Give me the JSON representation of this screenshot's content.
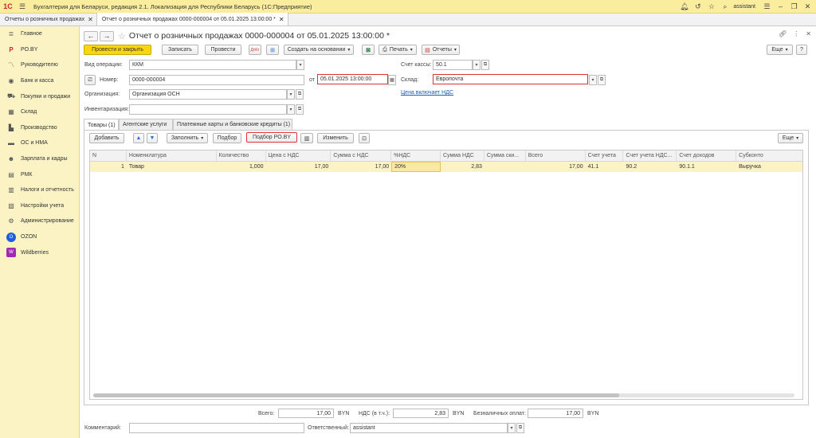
{
  "app": {
    "title": "Бухгалтерия для Беларуси, редакция 2.1. Локализация для Республики Беларусь   (1С:Предприятие)",
    "user": "assistant"
  },
  "window_tabs": [
    {
      "label": "Отчеты о розничных продажах"
    },
    {
      "label": "Отчет о розничных продажах 0000-000004 от 05.01.2025 13:00:00 *"
    }
  ],
  "sidebar": {
    "items": [
      {
        "label": "Главное",
        "icon": "menu-icon"
      },
      {
        "label": "PO.BY",
        "icon": "poby-icon"
      },
      {
        "label": "Руководителю",
        "icon": "chart-icon"
      },
      {
        "label": "Банк и касса",
        "icon": "bank-icon"
      },
      {
        "label": "Покупки и продажи",
        "icon": "cart-icon"
      },
      {
        "label": "Склад",
        "icon": "warehouse-icon"
      },
      {
        "label": "Производство",
        "icon": "factory-icon"
      },
      {
        "label": "ОС и НМА",
        "icon": "assets-icon"
      },
      {
        "label": "Зарплата и кадры",
        "icon": "people-icon"
      },
      {
        "label": "РМК",
        "icon": "register-icon"
      },
      {
        "label": "Налоги и отчетность",
        "icon": "taxes-icon"
      },
      {
        "label": "Настройки учета",
        "icon": "settings-doc-icon"
      },
      {
        "label": "Администрирование",
        "icon": "gear-icon"
      },
      {
        "label": "OZON",
        "icon": "ozon-icon"
      },
      {
        "label": "Wildberries",
        "icon": "wildberries-icon"
      }
    ]
  },
  "doc": {
    "title": "Отчет о розничных продажах 0000-000004 от 05.01.2025 13:00:00 *"
  },
  "toolbar": {
    "post_close": "Провести и закрыть",
    "save": "Записать",
    "post": "Провести",
    "create_based": "Создать на основании",
    "print": "Печать",
    "reports": "Отчеты",
    "more": "Еще"
  },
  "form": {
    "op_type_label": "Вид операции:",
    "op_type_value": "ККМ",
    "number_label": "Номер:",
    "number_value": "0000-000004",
    "date_label": "от",
    "date_value": "05.01.2025 13:00:00",
    "org_label": "Организация:",
    "org_value": "Организация ОСН",
    "inv_label": "Инвентаризация:",
    "inv_value": "",
    "cash_acc_label": "Счет кассы:",
    "cash_acc_value": "50.1",
    "warehouse_label": "Склад:",
    "warehouse_value": "Европочта",
    "vat_link": "Цена включает НДС"
  },
  "inner_tabs": [
    {
      "label": "Товары (1)"
    },
    {
      "label": "Агентские услуги"
    },
    {
      "label": "Платежные карты и банковские кредиты (1)"
    }
  ],
  "table_toolbar": {
    "add": "Добавить",
    "fill": "Заполнить",
    "pick": "Подбор",
    "pick_poby": "Подбор PO.BY",
    "change": "Изменить",
    "more": "Еще"
  },
  "table": {
    "columns": [
      "N",
      "Номенклатура",
      "Количество",
      "Цена с НДС",
      "Сумма с НДС",
      "%НДС",
      "Сумма НДС",
      "Сумма ски...",
      "Всего",
      "Счет учета",
      "Счет учета НДС...",
      "Счет доходов",
      "Субконто"
    ],
    "rows": [
      [
        "1",
        "Товар",
        "1,000",
        "17,00",
        "17,00",
        "20%",
        "2,83",
        "",
        "17,00",
        "41.1",
        "90.2",
        "90.1.1",
        "Выручка"
      ]
    ]
  },
  "totals": {
    "total_label": "Всего:",
    "total_value": "17,00",
    "total_currency": "BYN",
    "vat_label": "НДС (в т.ч.):",
    "vat_value": "2,83",
    "vat_currency": "BYN",
    "noncash_label": "Безналичных оплат:",
    "noncash_value": "17,00",
    "noncash_currency": "BYN"
  },
  "footer": {
    "comment_label": "Комментарий:",
    "comment_value": "",
    "responsible_label": "Ответственный:",
    "responsible_value": "assistant"
  }
}
